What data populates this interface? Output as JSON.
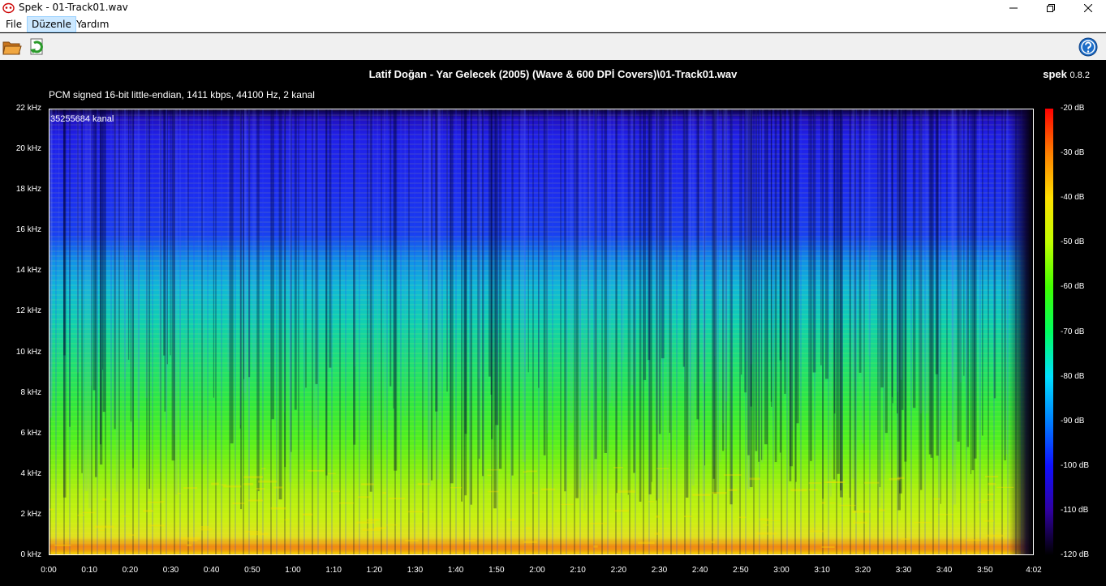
{
  "window": {
    "title": "Spek - 01-Track01.wav"
  },
  "menu": {
    "file": "File",
    "edit": "Düzenle",
    "help": "Yardım"
  },
  "spectrogram": {
    "file_title": "Latif Doğan - Yar Gelecek (2005) (Wave & 600 DPİ Covers)\\01-Track01.wav",
    "brand_name": "spek",
    "brand_version": "0.8.2",
    "format_info": "PCM signed 16-bit little-endian, 1411 kbps, 44100 Hz, 2 kanal",
    "sample_count": "35255684 kanal",
    "y_ticks": [
      "22 kHz",
      "20 kHz",
      "18 kHz",
      "16 kHz",
      "14 kHz",
      "12 kHz",
      "10 kHz",
      "8 kHz",
      "6 kHz",
      "4 kHz",
      "2 kHz",
      "0 kHz"
    ],
    "x_ticks": [
      "0:00",
      "0:10",
      "0:20",
      "0:30",
      "0:40",
      "0:50",
      "1:00",
      "1:10",
      "1:20",
      "1:30",
      "1:40",
      "1:50",
      "2:00",
      "2:10",
      "2:20",
      "2:30",
      "2:40",
      "2:50",
      "3:00",
      "3:10",
      "3:20",
      "3:30",
      "3:40",
      "3:50",
      "4:02"
    ],
    "db_ticks": [
      "-20 dB",
      "-30 dB",
      "-40 dB",
      "-50 dB",
      "-60 dB",
      "-70 dB",
      "-80 dB",
      "-90 dB",
      "-100 dB",
      "-110 dB",
      "-120 dB"
    ],
    "duration_seconds": 242,
    "x_tick_seconds": [
      0,
      10,
      20,
      30,
      40,
      50,
      60,
      70,
      80,
      90,
      100,
      110,
      120,
      130,
      140,
      150,
      160,
      170,
      180,
      190,
      200,
      210,
      220,
      230,
      242
    ],
    "freq_max_khz": 22,
    "db_range": [
      -120,
      -20
    ]
  }
}
